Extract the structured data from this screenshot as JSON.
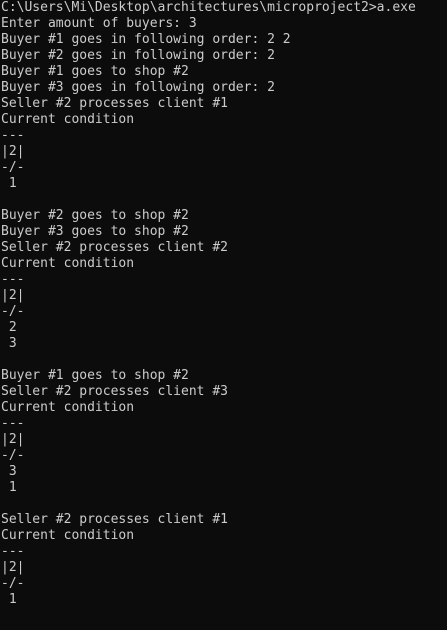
{
  "colors": {
    "background": "#0c0c0c",
    "text": "#cccccc"
  },
  "console": {
    "lines": [
      "C:\\Users\\Mi\\Desktop\\architectures\\microproject2>a.exe",
      "Enter amount of buyers: 3",
      "Buyer #1 goes in following order: 2 2",
      "Buyer #2 goes in following order: 2",
      "Buyer #1 goes to shop #2",
      "Buyer #3 goes in following order: 2",
      "Seller #2 processes client #1",
      "Current condition",
      "---",
      "|2|",
      "-/-",
      " 1",
      "",
      "Buyer #2 goes to shop #2",
      "Buyer #3 goes to shop #2",
      "Seller #2 processes client #2",
      "Current condition",
      "---",
      "|2|",
      "-/-",
      " 2",
      " 3",
      "",
      "Buyer #1 goes to shop #2",
      "Seller #2 processes client #3",
      "Current condition",
      "---",
      "|2|",
      "-/-",
      " 3",
      " 1",
      "",
      "Seller #2 processes client #1",
      "Current condition",
      "---",
      "|2|",
      "-/-",
      " 1"
    ]
  }
}
